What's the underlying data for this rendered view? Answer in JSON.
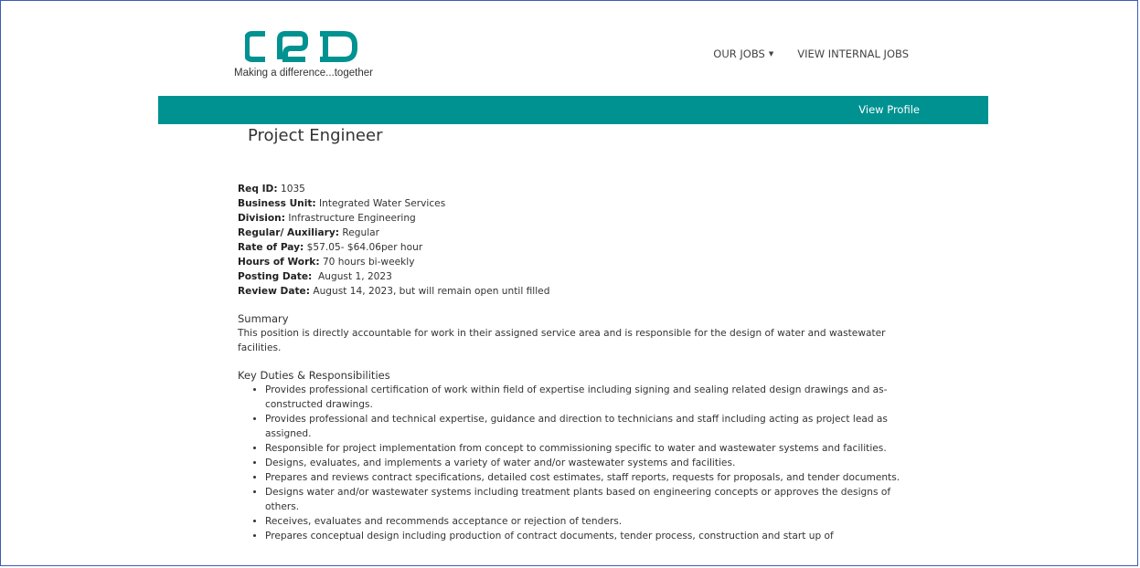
{
  "header": {
    "tagline": "Making a difference...together",
    "nav": [
      {
        "label": "OUR JOBS",
        "dropdown": true
      },
      {
        "label": "VIEW INTERNAL JOBS",
        "dropdown": false
      }
    ]
  },
  "bar": {
    "view_profile": "View Profile"
  },
  "colors": {
    "brand_teal": "#009291",
    "border": "#3c5bb6"
  },
  "job": {
    "title": "Project Engineer",
    "fields": [
      {
        "label": "Req ID:",
        "value": " 1035"
      },
      {
        "label": "Business Unit:",
        "value": " Integrated Water Services"
      },
      {
        "label": "Division:",
        "value": " Infrastructure Engineering"
      },
      {
        "label": "Regular/ Auxiliary:",
        "value": " Regular"
      },
      {
        "label": "Rate of Pay:",
        "value": " $57.05- $64.06per hour"
      },
      {
        "label": "Hours of Work:",
        "value": " 70 hours bi-weekly"
      },
      {
        "label": "Posting Date:",
        "value": "  August 1, 2023"
      },
      {
        "label": "Review Date:",
        "value": " August 14, 2023, but will remain open until filled"
      }
    ],
    "summary_heading": "Summary",
    "summary_text": "This position is directly accountable for work in their assigned service area and is responsible for the design of water and wastewater facilities.",
    "duties_heading": "Key Duties & Responsibilities",
    "duties": [
      "Provides professional certification of work within field of expertise including signing and sealing related design drawings and as-constructed drawings.",
      "Provides professional and technical expertise, guidance and direction to technicians and staff including acting as project lead as assigned.",
      "Responsible for project implementation from concept to commissioning specific to water and wastewater systems and facilities.",
      "Designs, evaluates, and implements a variety of water and/or wastewater systems and facilities.",
      "Prepares and reviews contract specifications, detailed cost estimates, staff reports, requests for proposals, and tender documents.",
      "Designs water and/or wastewater systems including treatment plants based on engineering concepts or approves the designs of others.",
      "Receives, evaluates and recommends acceptance or rejection of tenders.",
      "Prepares conceptual design including production of contract documents, tender process, construction and start up of"
    ]
  }
}
